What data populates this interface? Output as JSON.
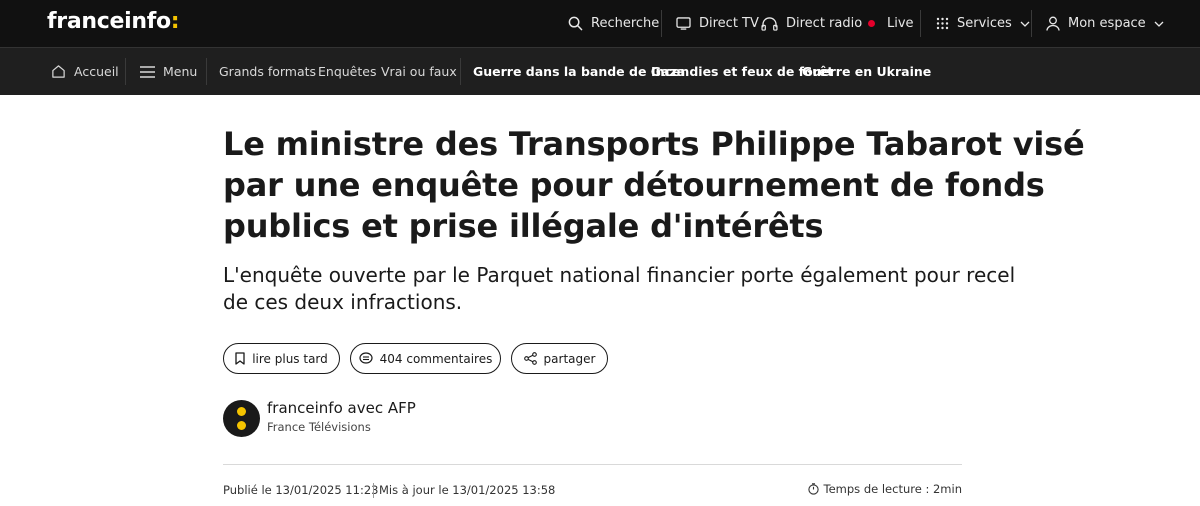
{
  "header": {
    "logo_text": "franceinfo",
    "logo_accent": ":",
    "search_label": "Recherche",
    "direct_tv_label": "Direct TV",
    "direct_radio_label": "Direct radio",
    "live_label": "Live",
    "services_label": "Services",
    "account_label": "Mon espace"
  },
  "nav": {
    "home_label": "Accueil",
    "menu_label": "Menu",
    "links": [
      "Grands formats",
      "Enquêtes",
      "Vrai ou faux"
    ],
    "topics": [
      "Guerre dans la bande de Gaza",
      "Incendies et feux de forêt",
      "Guerre en Ukraine"
    ]
  },
  "article": {
    "title_lines": [
      "Le ministre des Transports Philippe Tabarot visé",
      "par une enquête pour détournement de fonds",
      "publics et prise illégale d'intérêts"
    ],
    "subtitle_lines": [
      "L'enquête ouverte par le Parquet national financier porte également pour recel",
      "de ces deux infractions."
    ],
    "actions": {
      "read_later": "lire plus tard",
      "comments": "404 commentaires",
      "share": "partager"
    },
    "author": "franceinfo avec AFP",
    "organization": "France Télévisions",
    "published": "Publié le 13/01/2025 11:23",
    "updated": "Mis à jour le 13/01/2025 13:58",
    "reading_time": "Temps de lecture : 2min"
  },
  "colors": {
    "topbar_bg": "#111111",
    "navbar_bg": "#1f1f1f",
    "accent_yellow": "#f5c400",
    "live_red": "#e4002b"
  },
  "icons": {
    "search": "search-icon",
    "tv": "tv-icon",
    "radio": "headphones-icon",
    "services": "grid-icon",
    "account": "user-icon",
    "home": "home-icon",
    "menu": "hamburger-icon",
    "bookmark": "bookmark-icon",
    "comment": "comment-icon",
    "share": "share-icon",
    "clock": "clock-icon"
  }
}
